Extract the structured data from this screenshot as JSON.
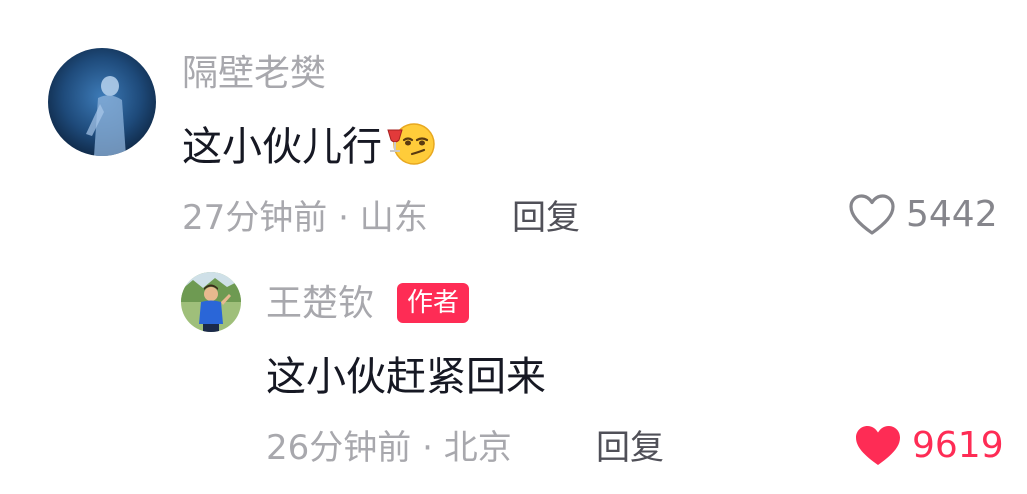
{
  "comment": {
    "username": "隔壁老樊",
    "text": "这小伙儿行",
    "emoji_icon": "wine-glass-smirk-emoji",
    "time": "27分钟前",
    "separator": "·",
    "location": "山东",
    "reply_label": "回复",
    "like_icon": "heart-outline-icon",
    "likes": "5442",
    "liked": false
  },
  "reply": {
    "username": "王楚钦",
    "badge": "作者",
    "text": "这小伙赶紧回来",
    "time": "26分钟前",
    "separator": "·",
    "location": "北京",
    "reply_label": "回复",
    "like_icon": "heart-filled-icon",
    "likes": "9619",
    "liked": true
  },
  "colors": {
    "secondary_text": "#a8a8ad",
    "primary_text": "#161823",
    "reply_text": "#505058",
    "accent": "#fe2c55"
  }
}
